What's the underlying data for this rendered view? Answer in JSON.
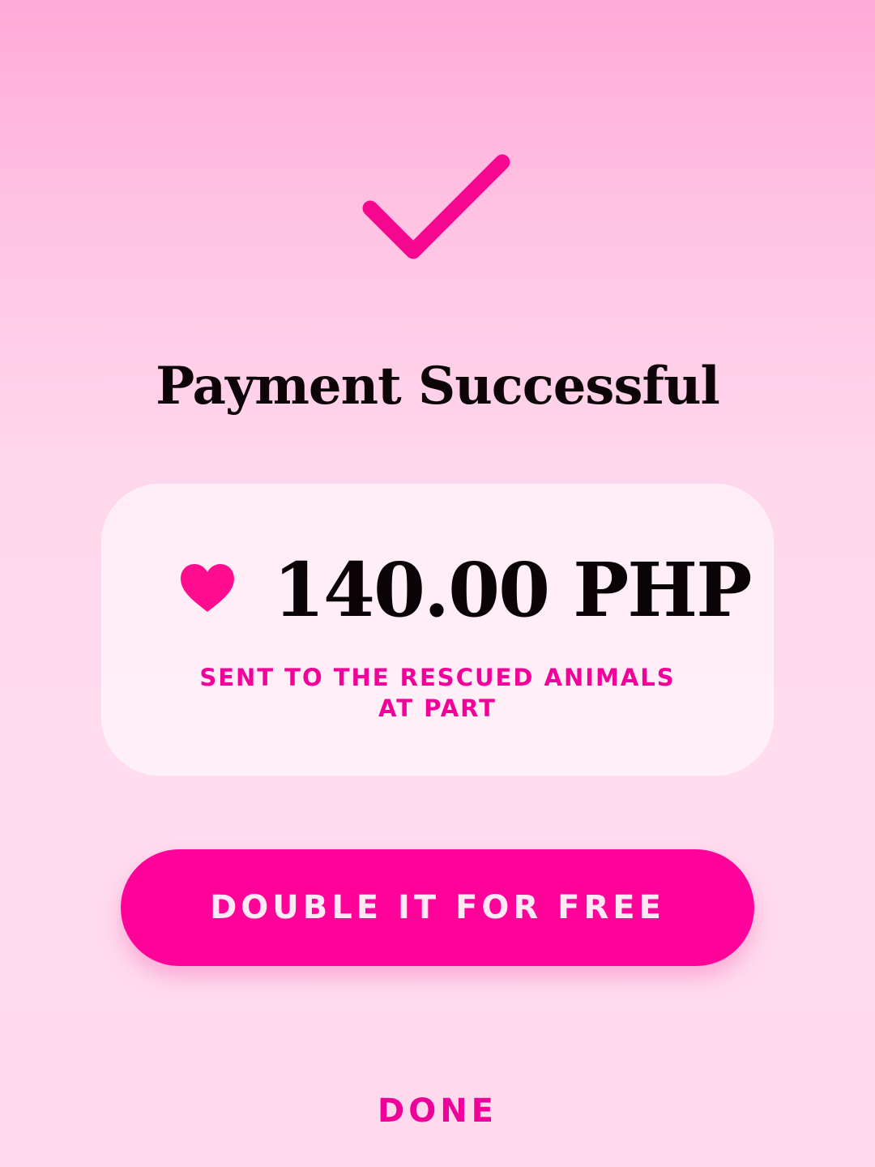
{
  "header": {
    "status_icon": "checkmark-icon",
    "title": "Payment Successful"
  },
  "amount_card": {
    "icon": "heart-icon",
    "amount": "140.00 PHP",
    "recipient_line1": "SENT TO THE RESCUED ANIMALS",
    "recipient_line2": "AT PART"
  },
  "actions": {
    "double_label": "DOUBLE IT FOR FREE",
    "done_label": "DONE"
  },
  "colors": {
    "accent": "#ff0299",
    "text_dark": "#0d0507",
    "background_top": "#ffa9d8",
    "background_bottom": "#ffdaed"
  }
}
